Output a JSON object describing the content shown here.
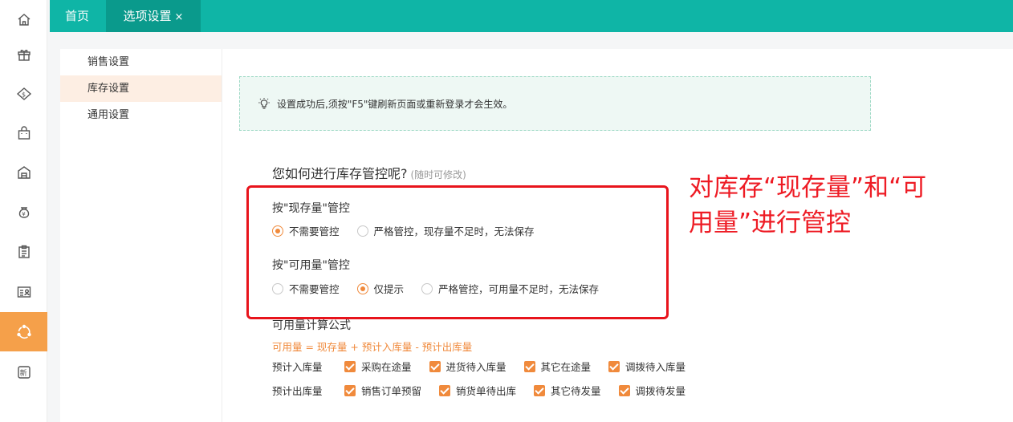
{
  "sidebar_icons": [
    "home-icon",
    "gift-icon",
    "money-house-icon",
    "shopping-bag-icon",
    "warehouse-icon",
    "money-bag-icon",
    "clipboard-icon",
    "id-card-icon",
    "refresh-cycle-icon",
    "new-badge-icon"
  ],
  "tabs": {
    "home": "首页",
    "options": "选项设置",
    "close": "×"
  },
  "menu": {
    "items": [
      "销售设置",
      "库存设置",
      "通用设置"
    ],
    "active_index": 1
  },
  "tip": {
    "text": "设置成功后,须按\"F5\"键刷新页面或重新登录才会生效。"
  },
  "question": {
    "title": "您如何进行库存管控呢?",
    "hint": "(随时可修改)"
  },
  "control_groups": [
    {
      "title": "按\"现存量\"管控",
      "options": [
        {
          "label": "不需要管控",
          "selected": true
        },
        {
          "label": "严格管控，现存量不足时，无法保存",
          "selected": false
        }
      ]
    },
    {
      "title": "按\"可用量\"管控",
      "options": [
        {
          "label": "不需要管控",
          "selected": false
        },
        {
          "label": "仅提示",
          "selected": true
        },
        {
          "label": "严格管控，可用量不足时，无法保存",
          "selected": false
        }
      ]
    }
  ],
  "formula": {
    "title": "可用量计算公式",
    "text": "可用量 = 现存量 + 预计入库量 - 预计出库量",
    "rows": [
      {
        "label": "预计入库量",
        "checks": [
          "采购在途量",
          "进货待入库量",
          "其它在途量",
          "调拨待入库量"
        ]
      },
      {
        "label": "预计出库量",
        "checks": [
          "销售订单预留",
          "销货单待出库",
          "其它待发量",
          "调拨待发量"
        ]
      }
    ]
  },
  "annotation": {
    "line1": "对库存“现存量”和“可",
    "line2": "用量”进行管控"
  },
  "colors": {
    "teal": "#0fb5a6",
    "orange": "#f08a3c",
    "annotation_red": "#e8141c"
  }
}
